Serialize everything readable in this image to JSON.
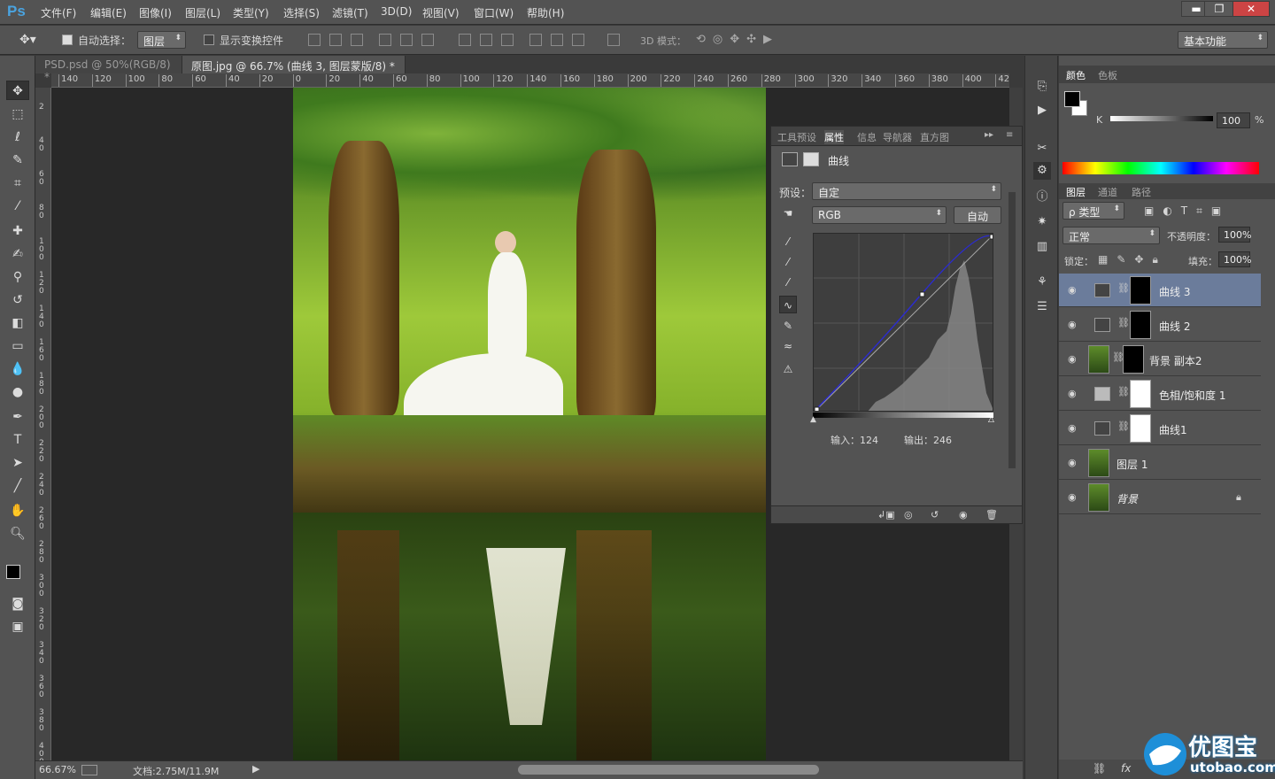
{
  "app": {
    "logo": "Ps"
  },
  "menu": [
    "文件(F)",
    "编辑(E)",
    "图像(I)",
    "图层(L)",
    "类型(Y)",
    "选择(S)",
    "滤镜(T)",
    "3D(D)",
    "视图(V)",
    "窗口(W)",
    "帮助(H)"
  ],
  "window_controls": {
    "minimize": "▬",
    "restore": "❐",
    "close": "✕"
  },
  "options": {
    "auto_select_label": "自动选择：",
    "auto_select_value": "图层",
    "show_transform_label": "显示变换控件",
    "mode_3d_label": "3D 模式：",
    "workspace": "基本功能"
  },
  "tabs": [
    {
      "label": "PSD.psd @ 50%(RGB/8) *",
      "close": "✕"
    },
    {
      "label": "原图.jpg @ 66.7% (曲线 3, 图层蒙版/8) *",
      "close": "✕"
    }
  ],
  "ruler_h": [
    "140",
    "120",
    "100",
    "80",
    "60",
    "40",
    "20",
    "0",
    "20",
    "40",
    "60",
    "80",
    "100",
    "120",
    "140",
    "160",
    "180",
    "200",
    "220",
    "240",
    "260",
    "280",
    "300",
    "320",
    "340",
    "360",
    "380",
    "400",
    "42"
  ],
  "ruler_v": [
    "2",
    "4 0",
    "6 0",
    "8 0",
    "1 0 0",
    "1 2 0",
    "1 4 0",
    "1 6 0",
    "1 8 0",
    "2 0 0",
    "2 2 0",
    "2 4 0",
    "2 6 0",
    "2 8 0",
    "3 0 0",
    "3 2 0",
    "3 4 0",
    "3 6 0",
    "3 8 0",
    "4 0 0"
  ],
  "status": {
    "zoom": "66.67%",
    "doc": "文档:2.75M/11.9M"
  },
  "properties": {
    "tabs": [
      "工具预设",
      "属性",
      "信息",
      "导航器",
      "直方图"
    ],
    "title": "曲线",
    "preset_label": "预设：",
    "preset_value": "自定",
    "channel": "RGB",
    "auto_label": "自动",
    "input_label": "输入：124",
    "output_label": "输出：246"
  },
  "color_panel": {
    "tabs": [
      "颜色",
      "色板"
    ],
    "k_label": "K",
    "k_value": "100",
    "percent": "%"
  },
  "layers_panel": {
    "tabs": [
      "图层",
      "通道",
      "路径"
    ],
    "filter_label": "ρ 类型",
    "blend_mode": "正常",
    "opacity_label": "不透明度：",
    "opacity_value": "100%",
    "lock_label": "锁定：",
    "fill_label": "填充：",
    "fill_value": "100%",
    "layers": [
      {
        "name": "曲线 3",
        "kind": "curves",
        "selected": true
      },
      {
        "name": "曲线 2",
        "kind": "curves",
        "selected": false
      },
      {
        "name": "背景 副本2",
        "kind": "image-mask",
        "selected": false
      },
      {
        "name": "色相/饱和度 1",
        "kind": "hue",
        "selected": false
      },
      {
        "name": "曲线1",
        "kind": "curves",
        "selected": false
      },
      {
        "name": "图层 1",
        "kind": "image",
        "selected": false
      },
      {
        "name": "背景",
        "kind": "background",
        "selected": false
      }
    ]
  },
  "watermark": {
    "text": "优图宝",
    "domain": "utobao.com"
  }
}
